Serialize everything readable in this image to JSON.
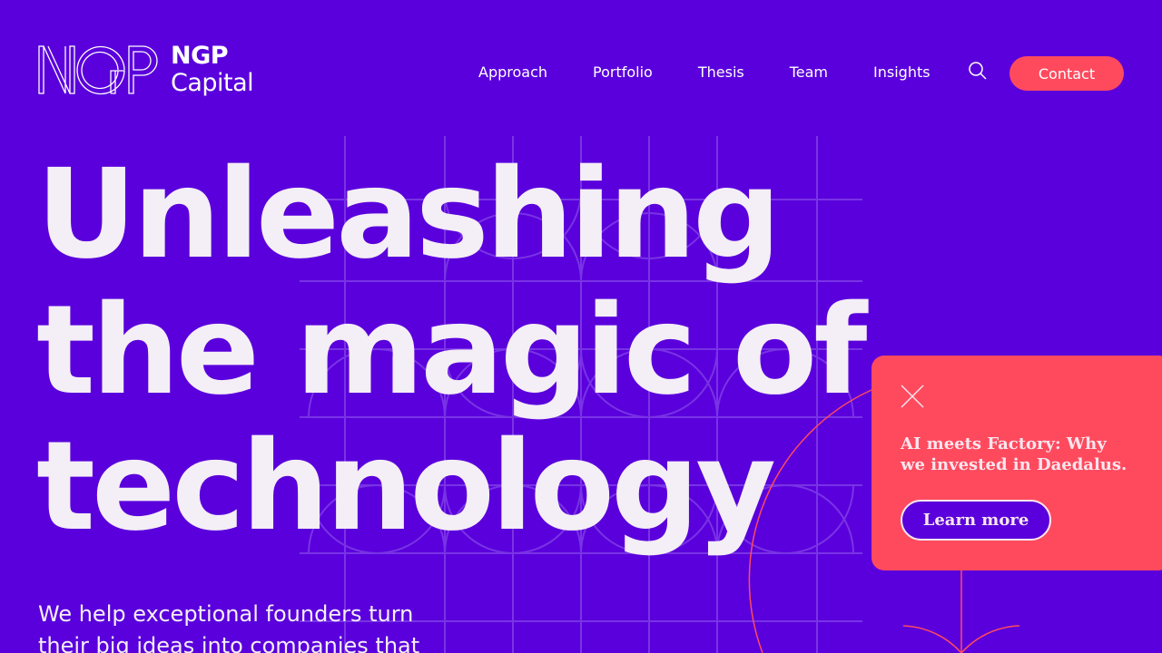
{
  "brand": {
    "name_line1": "NGP",
    "name_line2": "Capital",
    "logo_mark_icon": "ngp-outline-logo-icon"
  },
  "nav": {
    "items": [
      {
        "label": "Approach"
      },
      {
        "label": "Portfolio"
      },
      {
        "label": "Thesis"
      },
      {
        "label": "Team"
      },
      {
        "label": "Insights"
      }
    ],
    "search_icon": "search-icon",
    "contact_label": "Contact"
  },
  "hero": {
    "title_lines": [
      "Unleashing",
      "the magic of",
      "technology"
    ],
    "subtitle": "We help exceptional founders turn their big ideas into companies that"
  },
  "promo": {
    "close_icon": "close-icon",
    "text": "AI meets Factory: Why we invested in Daedalus.",
    "button_label": "Learn more"
  },
  "colors": {
    "background": "#5a00dc",
    "accent": "#ff4a5e",
    "text": "#f4eef6"
  }
}
